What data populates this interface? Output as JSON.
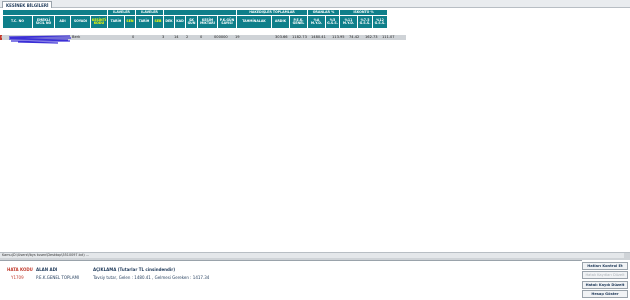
{
  "tab": {
    "label": "KESİNEK BİLGİLERİ"
  },
  "table": {
    "group_headers": {
      "ilaveler": "İLAVELER",
      "ilaveler2": "İLAVELER",
      "hakedis": "HAKEDİŞLER TOPLAMLAR",
      "oranlar": "ORANLAR %",
      "iskontolar": "İSKONTO %"
    },
    "columns": [
      "T.C. NO",
      "EMEKLİ SİCİL NO",
      "ADI",
      "SOYADI",
      "KESİNTİ KODU",
      "TARİH",
      "SEN",
      "TARİH",
      "SEB",
      "DEK",
      "KAD",
      "SK GÜN",
      "KESİM MİKTARI",
      "P.K.GÜN SAYISI",
      "TAHMİNALAK",
      "ARDIK",
      "P.E.K. GENEL",
      "%A M.Y.D.",
      "%5 G.S.S.",
      "%11 M.Y.D.",
      "%7.5 G.S.S.",
      "%12 G.S.S."
    ],
    "row": {
      "marker": "1",
      "name": "Berk",
      "tarih": "0",
      "tarih2": "3",
      "dek": "14",
      "kad": "2",
      "sk_gun": "0",
      "kesim": "000000",
      "pk_gun": "19",
      "tahmin": "303.66",
      "ardik": "1182.73",
      "pek": "1480.41",
      "myd": "113.95",
      "gss": "74.42",
      "myd11": "162.73",
      "gss75": "111.07"
    }
  },
  "status": {
    "text": "Kamu(D:\\Users\\fbys tusen\\Desktop\\5510097.txt) ..."
  },
  "info": {
    "hata_kodu_label": "HATA KODU",
    "hata_kodu_value": "Y1709",
    "alan_adi_label": "ALAN ADI",
    "alan_adi_value": "P.E.K.GENEL TOPLAMI",
    "aciklama": "AÇIKLAMA (Tutarlar TL cinsindendir)",
    "line1": "Tavsiy tutar, Gelen : 1480.41 , Gelmesi Gereken : 1417.34",
    "line2": ""
  },
  "buttons": [
    {
      "label": "Hatları Kontrol Et",
      "enabled": true
    },
    {
      "label": "Hatalı Kayıtları Düzelt",
      "enabled": false
    },
    {
      "label": "Hatalı Kaydı Düzelt",
      "enabled": true
    },
    {
      "label": "Hesap Göster",
      "enabled": true
    }
  ]
}
